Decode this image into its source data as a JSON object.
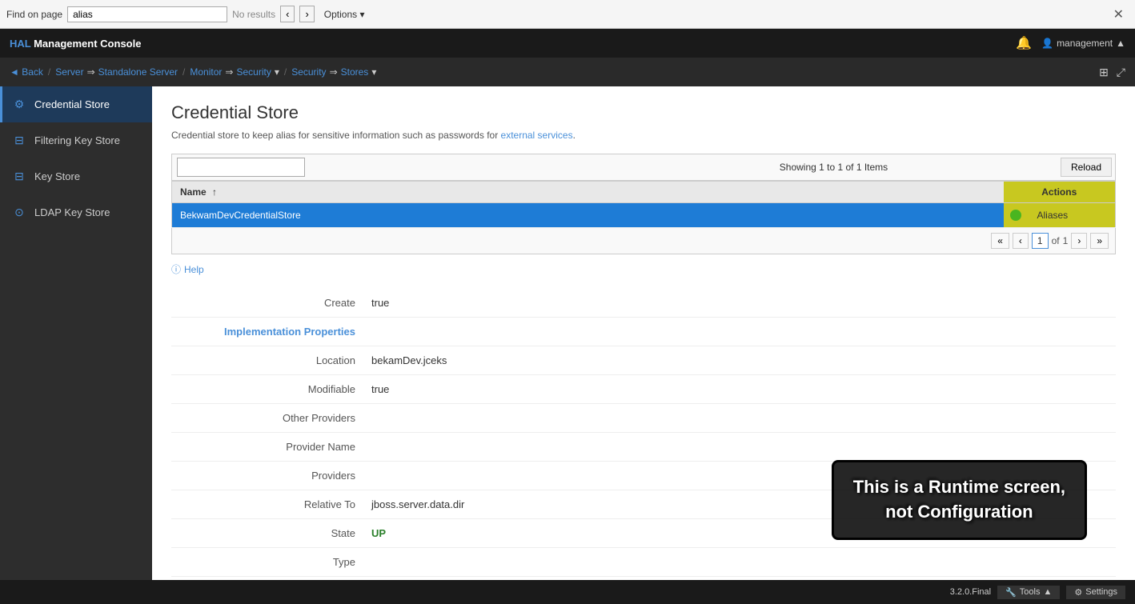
{
  "findBar": {
    "label": "Find on page",
    "inputValue": "alias",
    "noResults": "No results",
    "prevTitle": "Previous",
    "nextTitle": "Next",
    "optionsLabel": "Options ▾",
    "closeTitle": "Close"
  },
  "topNav": {
    "brand": "HAL Management Console",
    "brandHighlight": "HAL",
    "notifIcon": "🔔",
    "userIcon": "👤",
    "userName": "management",
    "userDropIcon": "▲"
  },
  "breadcrumb": {
    "back": "◄ Back",
    "server": "Server",
    "serverArrow": "⇒",
    "serverName": "Standalone Server",
    "monitor": "Monitor",
    "monitorArrow": "⇒",
    "security": "Security",
    "securityDropIcon": "▾",
    "securityStores": "Security",
    "securityStoresArrow": "⇒",
    "stores": "Stores",
    "storesDropIcon": "▾",
    "iconGrid": "⊞",
    "iconExternal": "⤢"
  },
  "sidebar": {
    "items": [
      {
        "id": "credential-store",
        "label": "Credential Store",
        "icon": "⚙",
        "active": true
      },
      {
        "id": "filtering-key-store",
        "label": "Filtering Key Store",
        "icon": "⊟",
        "active": false
      },
      {
        "id": "key-store",
        "label": "Key Store",
        "icon": "⊟",
        "active": false
      },
      {
        "id": "ldap-key-store",
        "label": "LDAP Key Store",
        "icon": "⊙",
        "active": false
      }
    ]
  },
  "mainContent": {
    "pageTitle": "Credential Store",
    "pageDesc": "Credential store to keep alias for sensitive information such as passwords for external services.",
    "pageDescLinkText": "external services",
    "tableSearch": "",
    "tableSearchPlaceholder": "",
    "showingText": "Showing 1 to 1 of 1 Items",
    "reloadBtn": "Reload",
    "tableColumns": {
      "name": "Name",
      "nameSortIcon": "↑",
      "actions": "Actions"
    },
    "tableRow": {
      "name": "BekwamDevCredentialStore",
      "aliasesBtn": "Aliases"
    },
    "pagination": {
      "first": "«",
      "prev": "‹",
      "page": "1",
      "of": "of",
      "total": "1",
      "next": "›",
      "last": "»"
    },
    "helpLink": "Help",
    "helpIcon": "ⓘ",
    "details": {
      "create": {
        "label": "Create",
        "value": "true"
      },
      "implProps": {
        "label": "Implementation Properties",
        "isSection": true
      },
      "location": {
        "label": "Location",
        "value": "bekamDev.jceks"
      },
      "modifiable": {
        "label": "Modifiable",
        "value": "true"
      },
      "otherProviders": {
        "label": "Other Providers",
        "value": ""
      },
      "providerName": {
        "label": "Provider Name",
        "value": ""
      },
      "providers": {
        "label": "Providers",
        "value": ""
      },
      "relativeTo": {
        "label": "Relative To",
        "value": "jboss.server.data.dir"
      },
      "state": {
        "label": "State",
        "value": "UP"
      },
      "type": {
        "label": "Type",
        "value": ""
      }
    }
  },
  "overlay": {
    "line1": "This is a Runtime screen,",
    "line2": "not Configuration"
  },
  "statusBar": {
    "version": "3.2.0.Final",
    "toolsLabel": "🔧 Tools",
    "toolsDropIcon": "▲",
    "settingsLabel": "⚙ Settings"
  }
}
